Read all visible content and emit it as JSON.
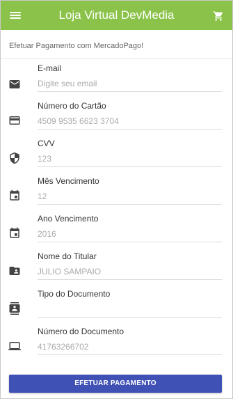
{
  "appbar": {
    "title": "Loja Virtual DevMedia",
    "menu_icon": "menu-icon",
    "cart_icon": "cart-icon",
    "color": "#8bc34a"
  },
  "subtitle": "Efetuar Pagamento com MercadoPago!",
  "fields": [
    {
      "label": "E-mail",
      "placeholder": "Digite seu email",
      "icon": "email-icon"
    },
    {
      "label": "Número do Cartão",
      "placeholder": "4509 9535 6623 3704",
      "icon": "credit-card-icon"
    },
    {
      "label": "CVV",
      "placeholder": "123",
      "icon": "shield-icon"
    },
    {
      "label": "Mês Vencimento",
      "placeholder": "12",
      "icon": "calendar-icon"
    },
    {
      "label": "Ano Vencimento",
      "placeholder": "2016",
      "icon": "calendar-icon"
    },
    {
      "label": "Nome do Titular",
      "placeholder": "JULIO SAMPAIO",
      "icon": "folder-shared-icon"
    },
    {
      "label": "Tipo do Documento",
      "placeholder": "",
      "icon": "contacts-icon"
    },
    {
      "label": "Número do Documento",
      "placeholder": "41763266702",
      "icon": "computer-icon"
    }
  ],
  "pay_button": {
    "label": "EFETUAR PAGAMENTO",
    "color": "#3f51b5"
  }
}
